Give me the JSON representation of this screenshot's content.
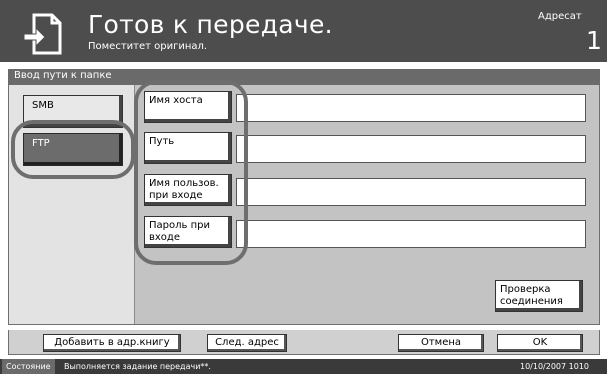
{
  "header": {
    "title": "Готов к передаче.",
    "subtitle": "Поместитет оригинал.",
    "destination_label": "Адресат",
    "destination_count": "1",
    "icon": "document-send-icon"
  },
  "section": {
    "title": "Ввод пути к папке"
  },
  "protocols": {
    "smb": "SMB",
    "ftp": "FTP",
    "selected": "FTP"
  },
  "fields": [
    {
      "label": "Имя хоста",
      "value": ""
    },
    {
      "label": "Путь",
      "value": ""
    },
    {
      "label": "Имя пользов. при входе",
      "value": ""
    },
    {
      "label": "Пароль при входе",
      "value": ""
    }
  ],
  "verify_button": "Проверка соединения",
  "footer": {
    "add_to_book": "Добавить в адр.книгу",
    "next_dest": "След. адрес",
    "cancel": "Отмена",
    "ok": "OK"
  },
  "status": {
    "label": "Состояние",
    "message": "Выполняется задание передачи**.",
    "datetime": "10/10/2007  1010"
  },
  "colors": {
    "header_bg": "#4d4d4d",
    "selected_bg": "#6c6c6c",
    "panel_bg": "#c3c3c3"
  }
}
